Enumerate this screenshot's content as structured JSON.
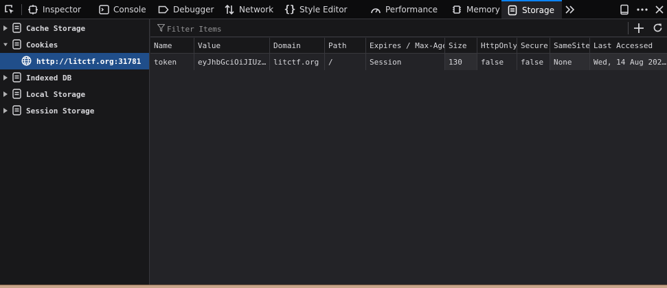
{
  "toolbar": {
    "tools": [
      {
        "label": "Inspector",
        "icon": "inspector-icon"
      },
      {
        "label": "Console",
        "icon": "console-icon"
      },
      {
        "label": "Debugger",
        "icon": "debugger-icon"
      },
      {
        "label": "Network",
        "icon": "network-icon"
      },
      {
        "label": "Style Editor",
        "icon": "style-editor-icon"
      },
      {
        "label": "Performance",
        "icon": "performance-icon"
      },
      {
        "label": "Memory",
        "icon": "memory-icon"
      },
      {
        "label": "Storage",
        "icon": "storage-icon",
        "selected": true
      }
    ],
    "accent": "#0a84ff"
  },
  "sidebar": {
    "items": [
      {
        "label": "Cache Storage",
        "expanded": false
      },
      {
        "label": "Cookies",
        "expanded": true
      },
      {
        "label": "http://litctf.org:31781",
        "selected": true
      },
      {
        "label": "Indexed DB",
        "expanded": false
      },
      {
        "label": "Local Storage",
        "expanded": false
      },
      {
        "label": "Session Storage",
        "expanded": false
      }
    ],
    "selected_color": "#204e8a"
  },
  "filter": {
    "placeholder": "Filter Items"
  },
  "table": {
    "columns": [
      "Name",
      "Value",
      "Domain",
      "Path",
      "Expires / Max-Age",
      "Size",
      "HttpOnly",
      "Secure",
      "SameSite",
      "Last Accessed"
    ],
    "rows": [
      [
        "token",
        "eyJhbGciOiJIUz…",
        "litctf.org",
        "/",
        "Session",
        "130",
        "false",
        "false",
        "None",
        "Wed, 14 Aug 202…"
      ]
    ]
  }
}
